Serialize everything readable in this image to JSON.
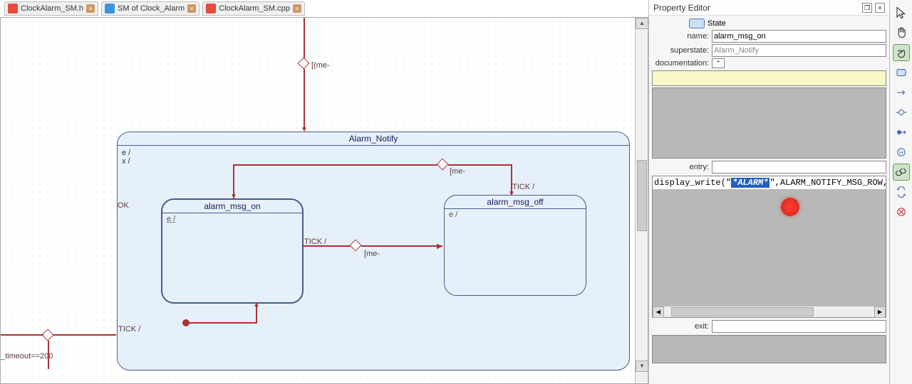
{
  "tabs": [
    {
      "label": "ClockAlarm_SM.h",
      "icon": "c"
    },
    {
      "label": "SM of Clock_Alarm",
      "icon": "sm"
    },
    {
      "label": "ClockAlarm_SM.cpp",
      "icon": "c"
    }
  ],
  "canvas": {
    "junction_label": "[(me-",
    "superstate": {
      "title": "Alarm_Notify",
      "entry_text": "e /",
      "exit_text": "x /",
      "ok_label": "OK"
    },
    "state_on": {
      "title": "alarm_msg_on",
      "entry_text": "e /"
    },
    "state_off": {
      "title": "alarm_msg_off",
      "entry_text": "e /"
    },
    "trans_me_top": "[me-",
    "trans_tick_right": "TICK /",
    "trans_tick_mid": "TICK /",
    "trans_me_mid": "[me-",
    "trans_tick_bottom": "TICK /",
    "trans_timeout": "_timeout==200"
  },
  "property_editor": {
    "title": "Property Editor",
    "type_label": "State",
    "name_label": "name:",
    "name_value": "alarm_msg_on",
    "superstate_label": "superstate:",
    "superstate_value": "Alarm_Notify",
    "documentation_label": "documentation:",
    "entry_label": "entry:",
    "code_plain_before": "display_write(\"",
    "code_highlight": "*ALARM*",
    "code_plain_after": "\",ALARM_NOTIFY_MSG_ROW,ALARM",
    "exit_label": "exit:"
  },
  "toolbar_icons": [
    "pointer-icon",
    "hand-icon",
    "grab-icon",
    "state-icon",
    "transition-icon",
    "choice-icon",
    "initial-icon",
    "history-icon",
    "link-icon",
    "sync-icon",
    "delete-icon"
  ]
}
